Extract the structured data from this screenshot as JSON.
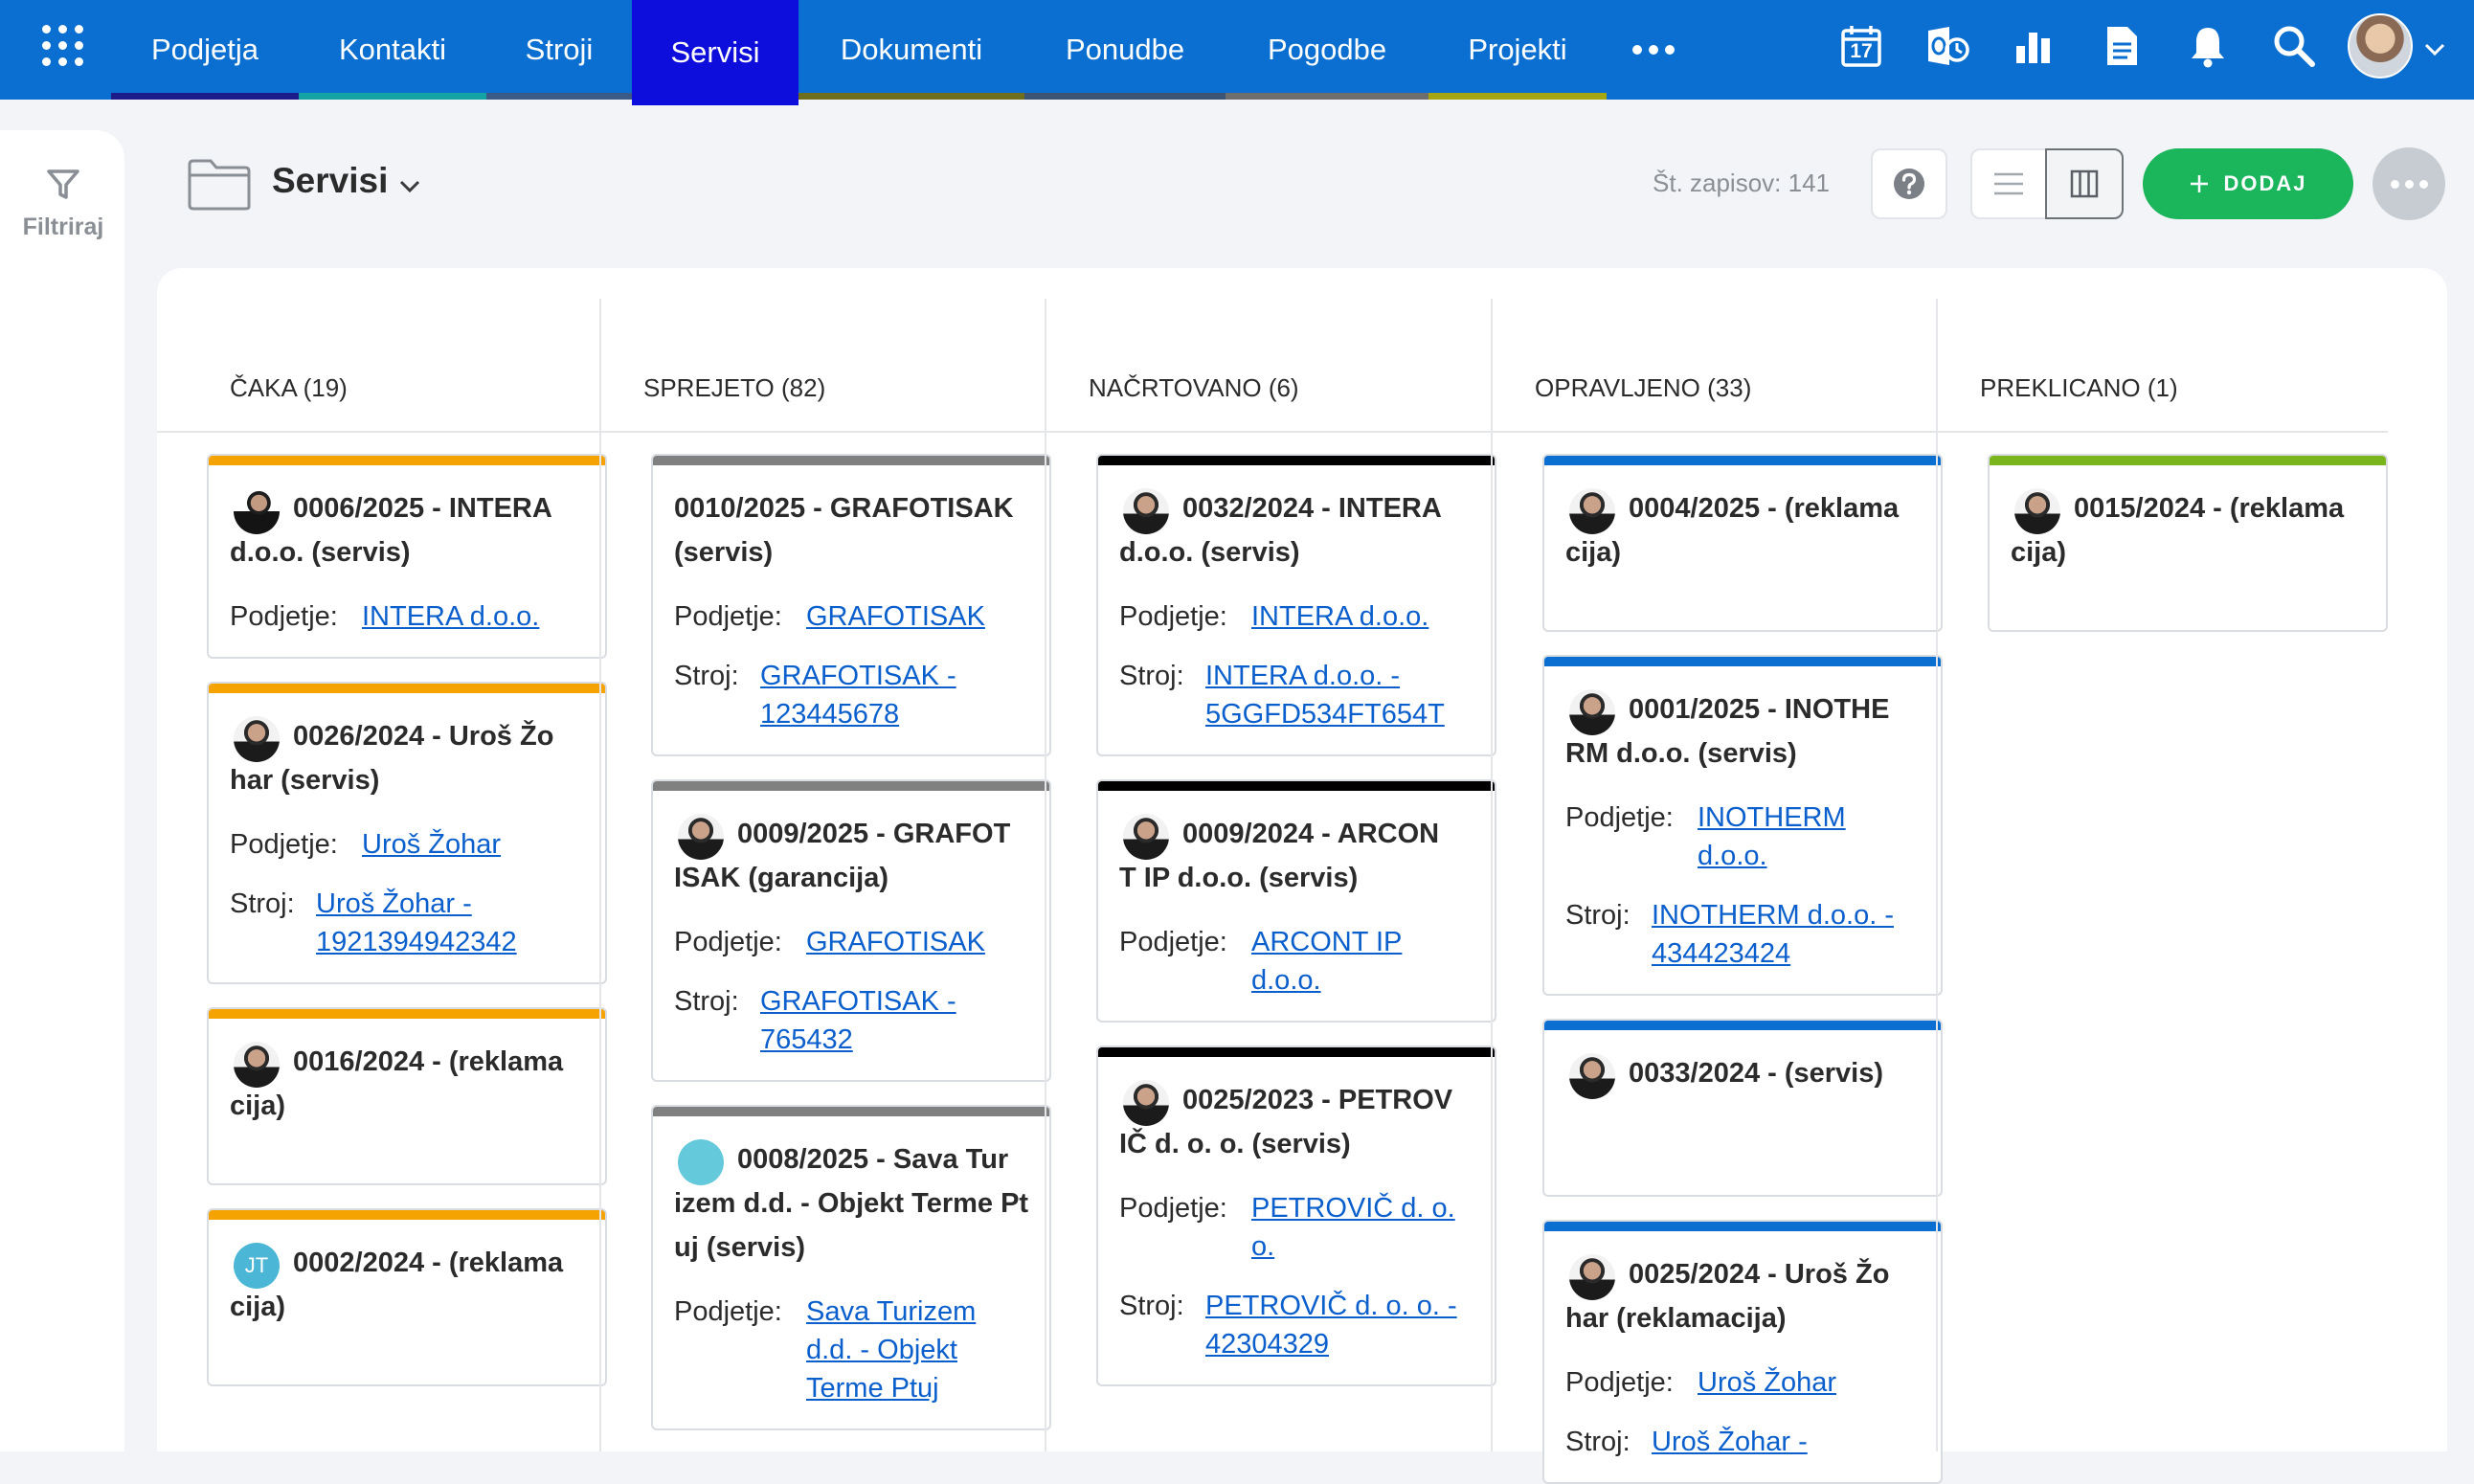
{
  "nav": {
    "tabs": [
      {
        "label": "Podjetja",
        "strip": "#1b1b8a"
      },
      {
        "label": "Kontakti",
        "strip": "#14a3a3"
      },
      {
        "label": "Stroji",
        "strip": "#3b5a86"
      },
      {
        "label": "Servisi",
        "strip": "#0d0ddc",
        "active": true
      },
      {
        "label": "Dokumenti",
        "strip": "#6e6e1e"
      },
      {
        "label": "Ponudbe",
        "strip": "#3c5574"
      },
      {
        "label": "Pogodbe",
        "strip": "#6e6e6e"
      },
      {
        "label": "Projekti",
        "strip": "#a6a612"
      }
    ],
    "calendar_day": "17",
    "icons": [
      "apps-grid-icon",
      "calendar-icon",
      "outlook-sync-icon",
      "reports-chart-icon",
      "document-icon",
      "notifications-bell-icon",
      "search-icon",
      "user-avatar",
      "chevron-down-icon"
    ]
  },
  "sidebar": {
    "filter_label": "Filtriraj"
  },
  "header": {
    "title": "Servisi",
    "record_count": "Št. zapisov: 141",
    "add_label": "DODAJ"
  },
  "colors": {
    "accent": "#0a6fd0",
    "add": "#1bb55c",
    "link": "#0a5fcc"
  },
  "board": {
    "columns": [
      {
        "title": "ČAKA (19)",
        "color": "#f5a300",
        "cards": [
          {
            "title": [
              "0006/2025 - INTERA",
              "d.o.o. (servis)"
            ],
            "avatar": "suit",
            "fields": [
              {
                "label": "Podjetje:",
                "lines": [
                  "INTERA d.o.o."
                ]
              }
            ]
          },
          {
            "title": [
              "0026/2024 - Uroš Žo",
              "har (servis)"
            ],
            "avatar": "man",
            "fields": [
              {
                "label": "Podjetje:",
                "lines": [
                  "Uroš Žohar"
                ]
              },
              {
                "label": "Stroj:",
                "lines": [
                  "Uroš Žohar -",
                  "1921394942342"
                ]
              }
            ]
          },
          {
            "title": [
              "0016/2024 - (reklama",
              "cija)"
            ],
            "avatar": "man",
            "fields": []
          },
          {
            "title": [
              "0002/2024 - (reklama",
              "cija)"
            ],
            "avatar": "initials",
            "initials": "JT",
            "fields": []
          }
        ]
      },
      {
        "title": "SPREJETO (82)",
        "color": "#808080",
        "cards": [
          {
            "title": [
              "0010/2025 - GRAFOTISAK",
              "(servis)"
            ],
            "avatar": "none",
            "fields": [
              {
                "label": "Podjetje:",
                "lines": [
                  "GRAFOTISAK"
                ]
              },
              {
                "label": "Stroj:",
                "lines": [
                  "GRAFOTISAK -",
                  "123445678"
                ]
              }
            ]
          },
          {
            "title": [
              "0009/2025 - GRAFOT",
              "ISAK (garancija)"
            ],
            "avatar": "man",
            "fields": [
              {
                "label": "Podjetje:",
                "lines": [
                  "GRAFOTISAK"
                ]
              },
              {
                "label": "Stroj:",
                "lines": [
                  "GRAFOTISAK -",
                  "765432"
                ]
              }
            ]
          },
          {
            "title": [
              "0008/2025 - Sava Tur",
              "izem d.d. - Objekt Terme Pt",
              "uj (servis)"
            ],
            "avatar": "blank",
            "fields": [
              {
                "label": "Podjetje:",
                "lines": [
                  "Sava Turizem",
                  "d.d. - Objekt",
                  "Terme Ptuj"
                ]
              }
            ]
          }
        ]
      },
      {
        "title": "NAČRTOVANO (6)",
        "color": "#000000",
        "cards": [
          {
            "title": [
              "0032/2024 - INTERA",
              "d.o.o. (servis)"
            ],
            "avatar": "man",
            "fields": [
              {
                "label": "Podjetje:",
                "lines": [
                  "INTERA d.o.o."
                ]
              },
              {
                "label": "Stroj:",
                "lines": [
                  "INTERA d.o.o. -",
                  "5GGFD534FT654T"
                ]
              }
            ]
          },
          {
            "title": [
              "0009/2024 - ARCON",
              "T IP d.o.o. (servis)"
            ],
            "avatar": "man",
            "fields": [
              {
                "label": "Podjetje:",
                "lines": [
                  "ARCONT IP",
                  "d.o.o."
                ]
              }
            ]
          },
          {
            "title": [
              "0025/2023 - PETROV",
              "IČ d. o. o. (servis)"
            ],
            "avatar": "man",
            "fields": [
              {
                "label": "Podjetje:",
                "lines": [
                  "PETROVIČ d. o.",
                  "o."
                ]
              },
              {
                "label": "Stroj:",
                "lines": [
                  "PETROVIČ d. o. o. -",
                  "42304329"
                ]
              }
            ]
          }
        ]
      },
      {
        "title": "OPRAVLJENO (33)",
        "color": "#0a6fd0",
        "cards": [
          {
            "title": [
              "0004/2025 - (reklama",
              "cija)"
            ],
            "avatar": "man",
            "fields": []
          },
          {
            "title": [
              "0001/2025 - INOTHE",
              "RM d.o.o. (servis)"
            ],
            "avatar": "man",
            "fields": [
              {
                "label": "Podjetje:",
                "lines": [
                  "INOTHERM",
                  "d.o.o."
                ]
              },
              {
                "label": "Stroj:",
                "lines": [
                  "INOTHERM d.o.o. -",
                  "434423424"
                ]
              }
            ]
          },
          {
            "title": [
              "0033/2024 - (servis)"
            ],
            "avatar": "man",
            "fields": []
          },
          {
            "title": [
              "0025/2024 - Uroš Žo",
              "har (reklamacija)"
            ],
            "avatar": "man",
            "fields": [
              {
                "label": "Podjetje:",
                "lines": [
                  "Uroš Žohar"
                ]
              },
              {
                "label": "Stroj:",
                "lines": [
                  "Uroš Žohar -"
                ]
              }
            ]
          }
        ]
      },
      {
        "title": "PREKLICANO (1)",
        "color": "#7ab51d",
        "cards": [
          {
            "title": [
              "0015/2024 - (reklama",
              "cija)"
            ],
            "avatar": "man",
            "fields": []
          }
        ]
      }
    ]
  }
}
